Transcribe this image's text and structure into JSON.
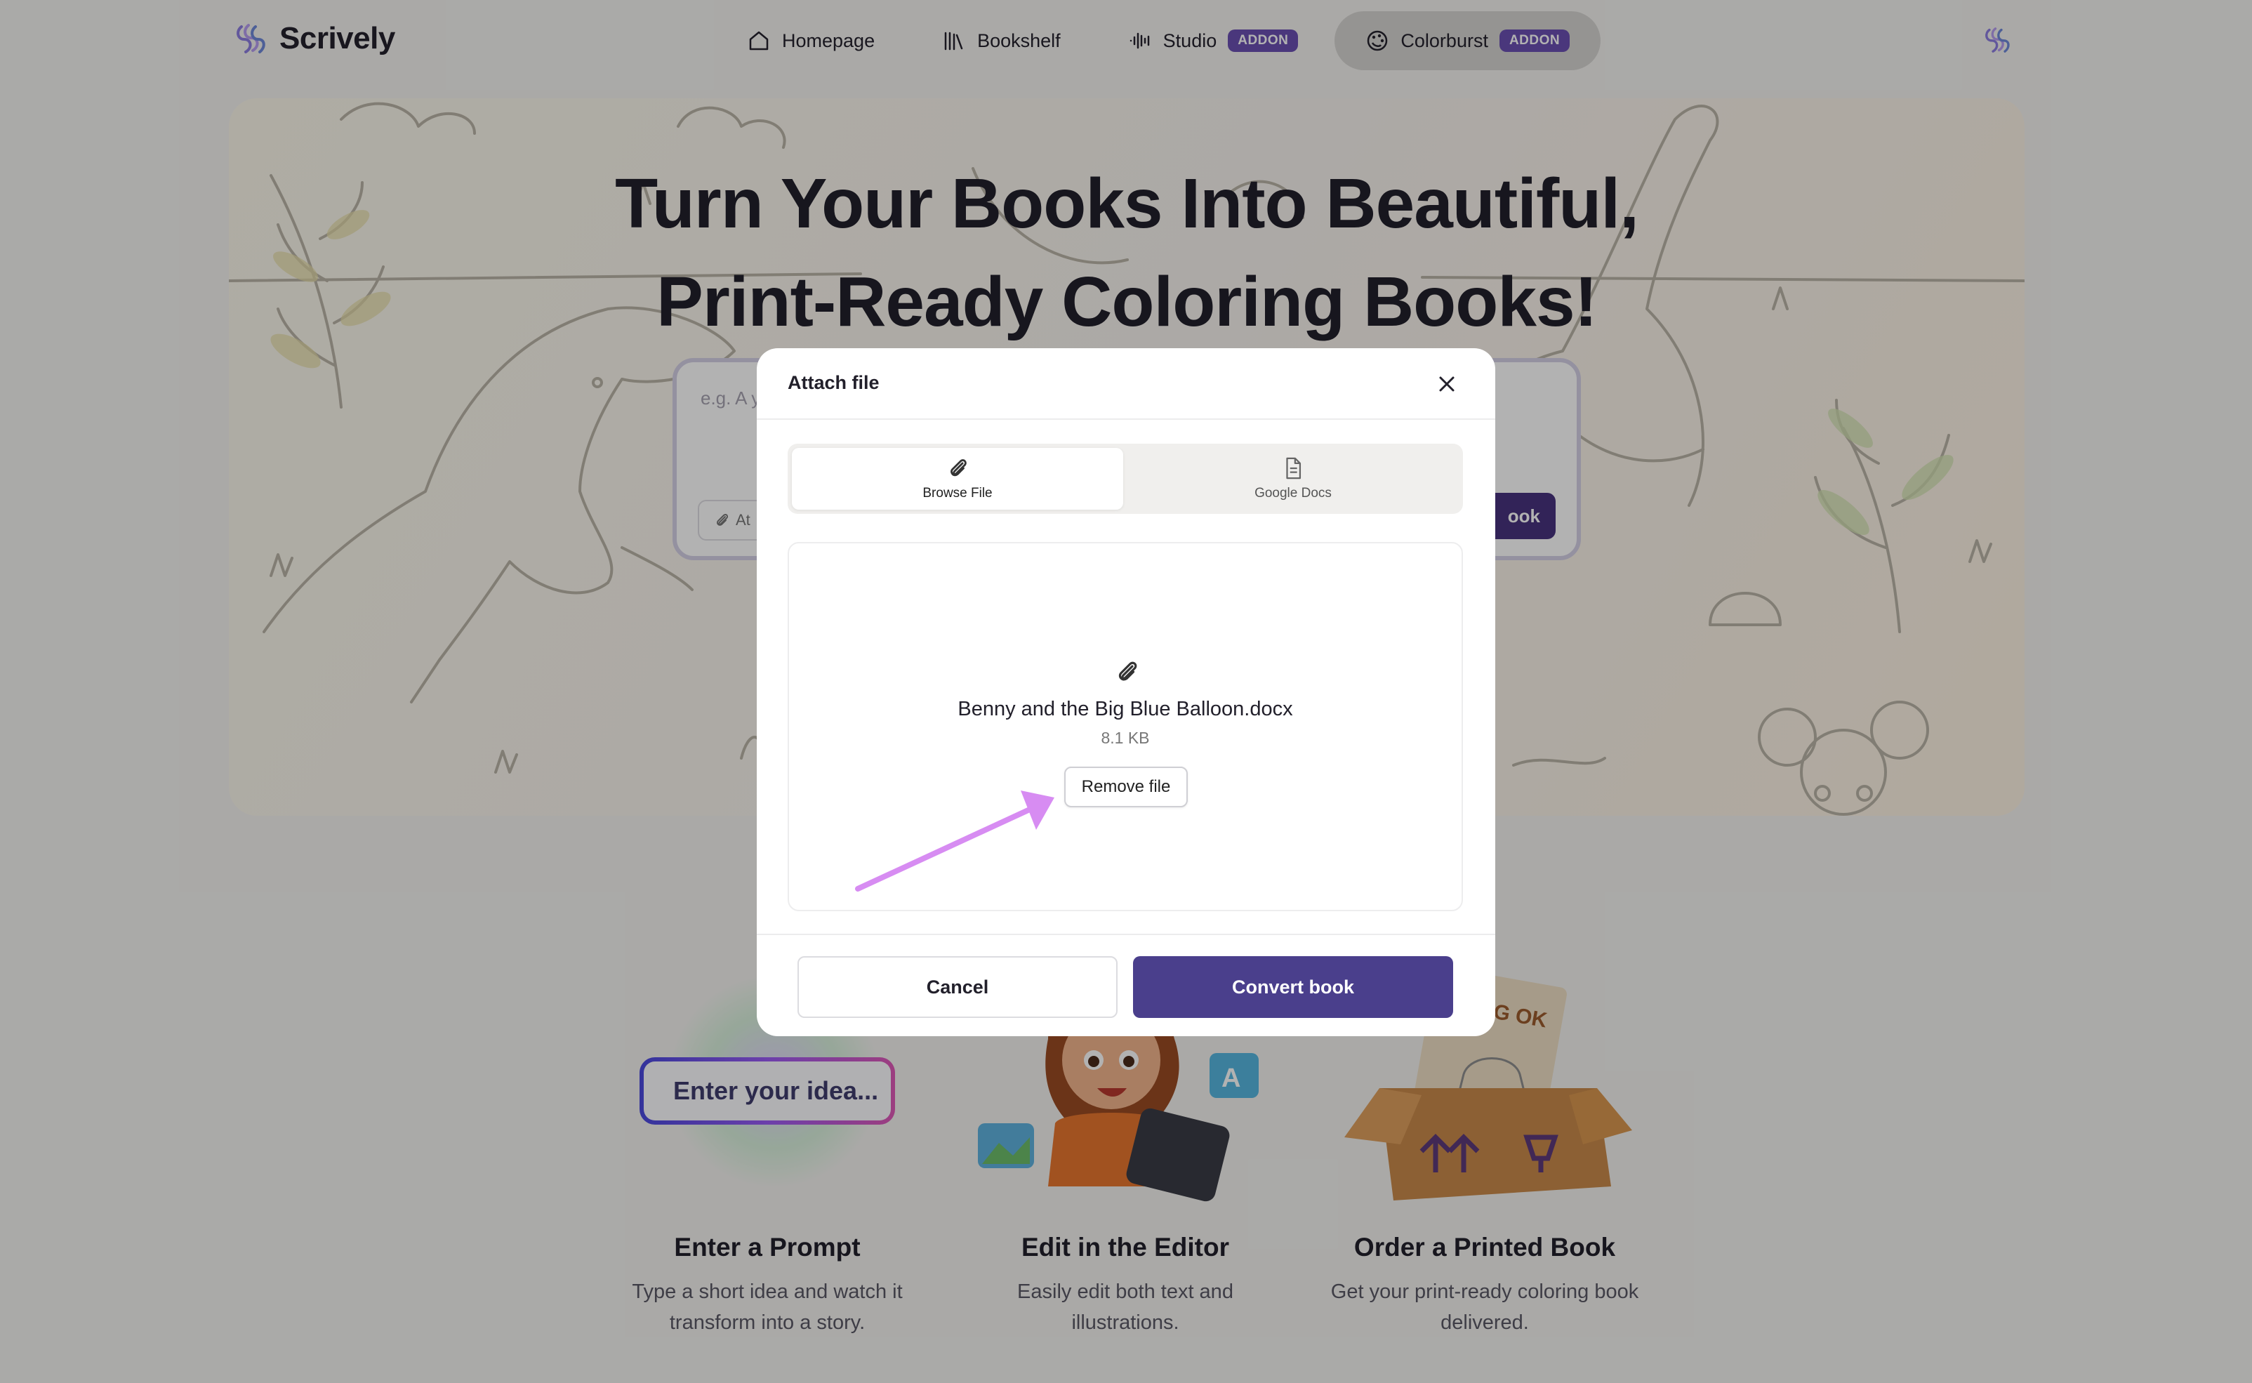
{
  "brand": {
    "name": "Scrively"
  },
  "nav": {
    "items": [
      {
        "label": "Homepage",
        "icon": "home-icon"
      },
      {
        "label": "Bookshelf",
        "icon": "books-icon"
      },
      {
        "label": "Studio",
        "icon": "waveform-icon",
        "badge": "ADDON"
      },
      {
        "label": "Colorburst",
        "icon": "palette-icon",
        "badge": "ADDON",
        "active": true
      }
    ]
  },
  "hero": {
    "title_line1": "Turn Your Books Into Beautiful,",
    "title_line2": "Print-Ready Coloring Books!",
    "prompt_placeholder": "e.g. A y",
    "attach_label": "At",
    "submit_label": "ook"
  },
  "steps": [
    {
      "title": "Enter a Prompt",
      "description": "Type a short idea and watch it transform into a story.",
      "illustration_text": "Enter your idea..."
    },
    {
      "title": "Edit in the Editor",
      "description": "Easily edit both text and illustrations."
    },
    {
      "title": "Order a Printed Book",
      "description": "Get your print-ready coloring book delivered.",
      "illustration_text": "RING OK"
    }
  ],
  "modal": {
    "title": "Attach file",
    "tabs": [
      {
        "label": "Browse File",
        "icon": "paperclip-icon",
        "selected": true
      },
      {
        "label": "Google Docs",
        "icon": "document-icon",
        "selected": false
      }
    ],
    "file": {
      "name": "Benny and the Big Blue Balloon.docx",
      "size": "8.1 KB"
    },
    "remove_label": "Remove file",
    "cancel_label": "Cancel",
    "convert_label": "Convert book"
  },
  "colors": {
    "accent": "#4a3f8c",
    "badge": "#6b4fb2",
    "annotation_arrow": "#d78cf2"
  }
}
